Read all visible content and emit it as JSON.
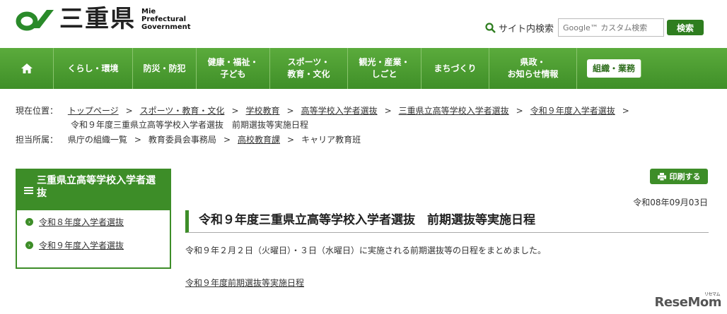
{
  "header": {
    "logo_kanji": "三重県",
    "logo_en": [
      "Mie",
      "Prefectural",
      "Government"
    ],
    "search_label": "サイト内検索",
    "search_placeholder": "Google™ カスタム検索",
    "search_button": "検索"
  },
  "nav": {
    "items": [
      {
        "label": "くらし・環境"
      },
      {
        "label": "防災・防犯"
      },
      {
        "label": "健康・福祉・\n子ども"
      },
      {
        "label": "スポーツ・\n教育・文化"
      },
      {
        "label": "観光・産業・\nしごと"
      },
      {
        "label": "まちづくり"
      },
      {
        "label": "県政・\nお知らせ情報"
      },
      {
        "label": "組織・業務"
      }
    ]
  },
  "breadcrumb": {
    "current_label": "現在位置：",
    "items": [
      "トップページ",
      "スポーツ・教育・文化",
      "学校教育",
      "高等学校入学者選抜",
      "三重県立高等学校入学者選抜",
      "令和９年度入学者選抜"
    ],
    "current": "令和９年度三重県立高等学校入学者選抜　前期選抜等実施日程",
    "dept_label": "担当所属：",
    "dept_items": [
      "県庁の組織一覧",
      "教育委員会事務局",
      "高校教育課",
      "キャリア教育班"
    ]
  },
  "sidebar": {
    "heading": "三重県立高等学校入学者選抜",
    "items": [
      "令和８年度入学者選抜",
      "令和９年度入学者選抜"
    ]
  },
  "main": {
    "print_label": "印刷する",
    "date": "令和08年09月03日",
    "title": "令和９年度三重県立高等学校入学者選抜　前期選抜等実施日程",
    "body": "令和９年２月２日（火曜日）・３日（水曜日）に実施される前期選抜等の日程をまとめました。",
    "link": "令和９年度前期選抜等実施日程"
  },
  "watermark": "ReseMom",
  "colors": {
    "brand_green": "#3d8d28",
    "nav_green": "#4e9f33"
  }
}
